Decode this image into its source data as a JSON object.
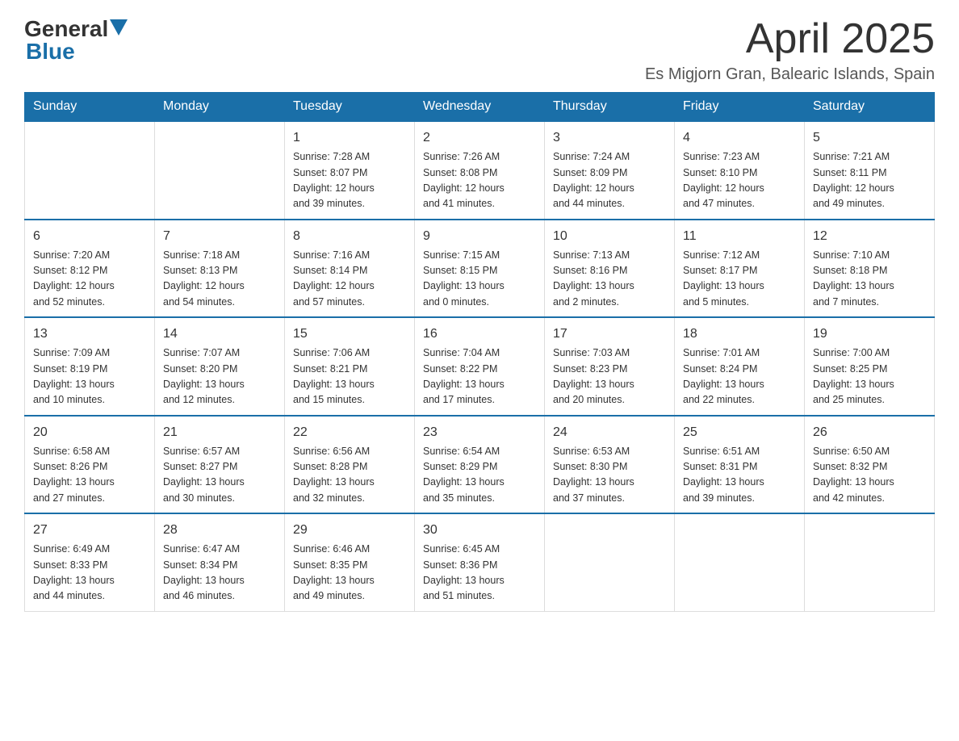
{
  "header": {
    "logo_general": "General",
    "logo_blue": "Blue",
    "month_title": "April 2025",
    "location": "Es Migjorn Gran, Balearic Islands, Spain"
  },
  "weekdays": [
    "Sunday",
    "Monday",
    "Tuesday",
    "Wednesday",
    "Thursday",
    "Friday",
    "Saturday"
  ],
  "weeks": [
    [
      {
        "day": "",
        "info": ""
      },
      {
        "day": "",
        "info": ""
      },
      {
        "day": "1",
        "info": "Sunrise: 7:28 AM\nSunset: 8:07 PM\nDaylight: 12 hours\nand 39 minutes."
      },
      {
        "day": "2",
        "info": "Sunrise: 7:26 AM\nSunset: 8:08 PM\nDaylight: 12 hours\nand 41 minutes."
      },
      {
        "day": "3",
        "info": "Sunrise: 7:24 AM\nSunset: 8:09 PM\nDaylight: 12 hours\nand 44 minutes."
      },
      {
        "day": "4",
        "info": "Sunrise: 7:23 AM\nSunset: 8:10 PM\nDaylight: 12 hours\nand 47 minutes."
      },
      {
        "day": "5",
        "info": "Sunrise: 7:21 AM\nSunset: 8:11 PM\nDaylight: 12 hours\nand 49 minutes."
      }
    ],
    [
      {
        "day": "6",
        "info": "Sunrise: 7:20 AM\nSunset: 8:12 PM\nDaylight: 12 hours\nand 52 minutes."
      },
      {
        "day": "7",
        "info": "Sunrise: 7:18 AM\nSunset: 8:13 PM\nDaylight: 12 hours\nand 54 minutes."
      },
      {
        "day": "8",
        "info": "Sunrise: 7:16 AM\nSunset: 8:14 PM\nDaylight: 12 hours\nand 57 minutes."
      },
      {
        "day": "9",
        "info": "Sunrise: 7:15 AM\nSunset: 8:15 PM\nDaylight: 13 hours\nand 0 minutes."
      },
      {
        "day": "10",
        "info": "Sunrise: 7:13 AM\nSunset: 8:16 PM\nDaylight: 13 hours\nand 2 minutes."
      },
      {
        "day": "11",
        "info": "Sunrise: 7:12 AM\nSunset: 8:17 PM\nDaylight: 13 hours\nand 5 minutes."
      },
      {
        "day": "12",
        "info": "Sunrise: 7:10 AM\nSunset: 8:18 PM\nDaylight: 13 hours\nand 7 minutes."
      }
    ],
    [
      {
        "day": "13",
        "info": "Sunrise: 7:09 AM\nSunset: 8:19 PM\nDaylight: 13 hours\nand 10 minutes."
      },
      {
        "day": "14",
        "info": "Sunrise: 7:07 AM\nSunset: 8:20 PM\nDaylight: 13 hours\nand 12 minutes."
      },
      {
        "day": "15",
        "info": "Sunrise: 7:06 AM\nSunset: 8:21 PM\nDaylight: 13 hours\nand 15 minutes."
      },
      {
        "day": "16",
        "info": "Sunrise: 7:04 AM\nSunset: 8:22 PM\nDaylight: 13 hours\nand 17 minutes."
      },
      {
        "day": "17",
        "info": "Sunrise: 7:03 AM\nSunset: 8:23 PM\nDaylight: 13 hours\nand 20 minutes."
      },
      {
        "day": "18",
        "info": "Sunrise: 7:01 AM\nSunset: 8:24 PM\nDaylight: 13 hours\nand 22 minutes."
      },
      {
        "day": "19",
        "info": "Sunrise: 7:00 AM\nSunset: 8:25 PM\nDaylight: 13 hours\nand 25 minutes."
      }
    ],
    [
      {
        "day": "20",
        "info": "Sunrise: 6:58 AM\nSunset: 8:26 PM\nDaylight: 13 hours\nand 27 minutes."
      },
      {
        "day": "21",
        "info": "Sunrise: 6:57 AM\nSunset: 8:27 PM\nDaylight: 13 hours\nand 30 minutes."
      },
      {
        "day": "22",
        "info": "Sunrise: 6:56 AM\nSunset: 8:28 PM\nDaylight: 13 hours\nand 32 minutes."
      },
      {
        "day": "23",
        "info": "Sunrise: 6:54 AM\nSunset: 8:29 PM\nDaylight: 13 hours\nand 35 minutes."
      },
      {
        "day": "24",
        "info": "Sunrise: 6:53 AM\nSunset: 8:30 PM\nDaylight: 13 hours\nand 37 minutes."
      },
      {
        "day": "25",
        "info": "Sunrise: 6:51 AM\nSunset: 8:31 PM\nDaylight: 13 hours\nand 39 minutes."
      },
      {
        "day": "26",
        "info": "Sunrise: 6:50 AM\nSunset: 8:32 PM\nDaylight: 13 hours\nand 42 minutes."
      }
    ],
    [
      {
        "day": "27",
        "info": "Sunrise: 6:49 AM\nSunset: 8:33 PM\nDaylight: 13 hours\nand 44 minutes."
      },
      {
        "day": "28",
        "info": "Sunrise: 6:47 AM\nSunset: 8:34 PM\nDaylight: 13 hours\nand 46 minutes."
      },
      {
        "day": "29",
        "info": "Sunrise: 6:46 AM\nSunset: 8:35 PM\nDaylight: 13 hours\nand 49 minutes."
      },
      {
        "day": "30",
        "info": "Sunrise: 6:45 AM\nSunset: 8:36 PM\nDaylight: 13 hours\nand 51 minutes."
      },
      {
        "day": "",
        "info": ""
      },
      {
        "day": "",
        "info": ""
      },
      {
        "day": "",
        "info": ""
      }
    ]
  ]
}
